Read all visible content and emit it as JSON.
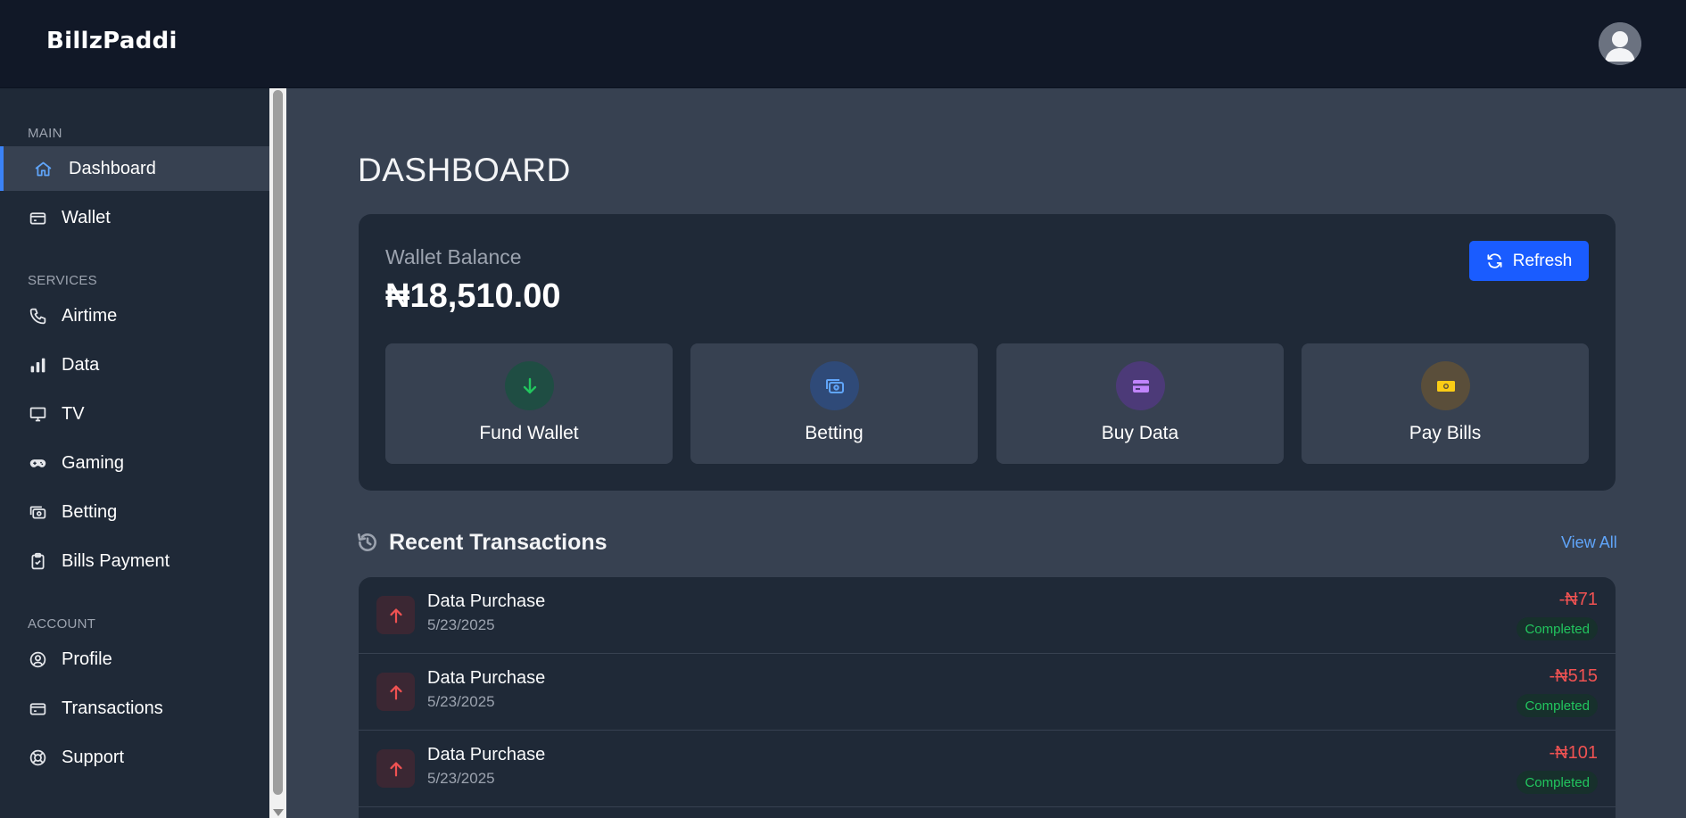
{
  "header": {
    "logo": "BillzPaddi",
    "avatar_icon": "user-avatar-icon"
  },
  "sidebar": {
    "sections": [
      {
        "label": "MAIN",
        "items": [
          {
            "label": "Dashboard",
            "icon": "home-icon",
            "active": true
          },
          {
            "label": "Wallet",
            "icon": "wallet-icon"
          }
        ]
      },
      {
        "label": "SERVICES",
        "items": [
          {
            "label": "Airtime",
            "icon": "phone-icon"
          },
          {
            "label": "Data",
            "icon": "signal-bars-icon"
          },
          {
            "label": "TV",
            "icon": "tv-icon"
          },
          {
            "label": "Gaming",
            "icon": "gamepad-icon"
          },
          {
            "label": "Betting",
            "icon": "money-icon"
          },
          {
            "label": "Bills Payment",
            "icon": "clipboard-check-icon"
          }
        ]
      },
      {
        "label": "ACCOUNT",
        "items": [
          {
            "label": "Profile",
            "icon": "user-circle-icon"
          },
          {
            "label": "Transactions",
            "icon": "card-icon"
          },
          {
            "label": "Support",
            "icon": "lifebuoy-icon"
          }
        ]
      }
    ]
  },
  "main": {
    "title": "DASHBOARD",
    "wallet": {
      "label": "Wallet Balance",
      "balance": "₦18,510.00",
      "refresh_label": "Refresh"
    },
    "actions": [
      {
        "label": "Fund Wallet",
        "icon": "arrow-down-icon",
        "color": "#22c55e"
      },
      {
        "label": "Betting",
        "icon": "money-icon",
        "color": "#60a5fa"
      },
      {
        "label": "Buy Data",
        "icon": "card-icon",
        "color": "#c084fc"
      },
      {
        "label": "Pay Bills",
        "icon": "banknote-icon",
        "color": "#facc15"
      }
    ],
    "recent": {
      "title": "Recent Transactions",
      "view_all": "View All",
      "items": [
        {
          "name": "Data Purchase",
          "date": "5/23/2025",
          "amount": "-₦71",
          "status": "Completed"
        },
        {
          "name": "Data Purchase",
          "date": "5/23/2025",
          "amount": "-₦515",
          "status": "Completed"
        },
        {
          "name": "Data Purchase",
          "date": "5/23/2025",
          "amount": "-₦101",
          "status": "Completed"
        }
      ]
    }
  },
  "colors": {
    "accent": "#3b82f6",
    "primary_button": "#1a5cff",
    "debit": "#f05252",
    "success": "#22c55e"
  }
}
